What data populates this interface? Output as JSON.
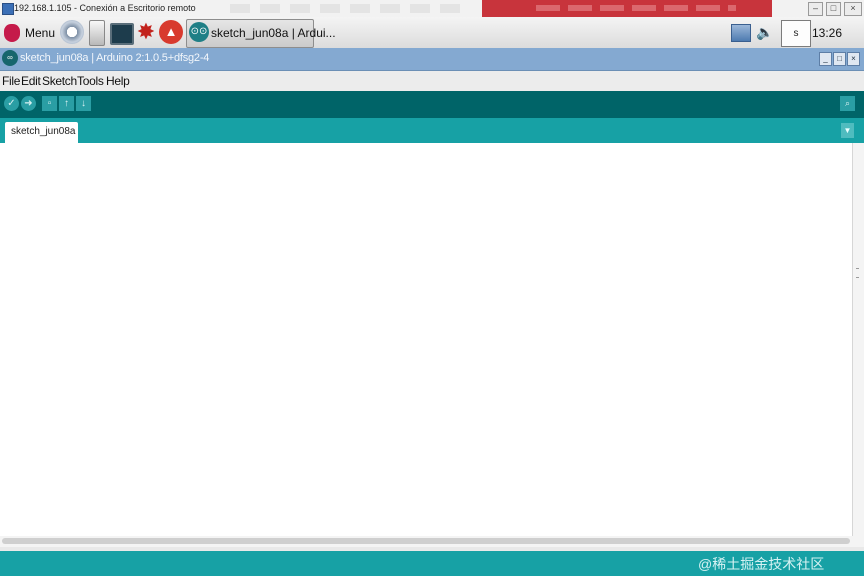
{
  "rdp": {
    "title": "192.168.1.105 - Conexión a Escritorio remoto",
    "controls": [
      "–",
      "□",
      "×"
    ]
  },
  "taskbar": {
    "menu_label": "Menu",
    "active_window_label": "sketch_jun08a | Ardui...",
    "cpu_label": "s",
    "clock": "13:26",
    "icons": [
      "raspberry-logo-icon",
      "web-browser-icon",
      "file-manager-icon",
      "terminal-icon",
      "mathematica-icon",
      "wolfram-icon",
      "arduino-icon",
      "network-icon",
      "volume-icon",
      "cpu-monitor-icon"
    ]
  },
  "window": {
    "title": "sketch_jun08a | Arduino 2:1.0.5+dfsg2-4",
    "controls": [
      "_",
      "□",
      "×"
    ]
  },
  "menu": {
    "items": [
      "File",
      "Edit",
      "Sketch",
      "Tools",
      "Help"
    ]
  },
  "toolbar": {
    "buttons": [
      "verify-icon",
      "upload-icon",
      "new-icon",
      "open-icon",
      "save-icon",
      "serial-monitor-icon"
    ]
  },
  "tabs": [
    {
      "label": "sketch_jun08a",
      "active": true
    }
  ],
  "editor": {
    "content": ""
  },
  "watermark": "@稀土掘金技术社区",
  "colors": {
    "toolbar": "#006468",
    "tabstrip": "#17a1a5",
    "title_bar": "#84a9d1",
    "rdp_highlight": "#c8343c"
  }
}
